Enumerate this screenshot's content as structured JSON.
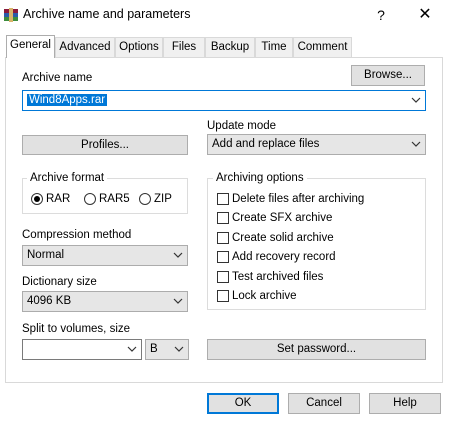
{
  "window": {
    "title": "Archive name and parameters",
    "help_label": "?",
    "close_label": "✕"
  },
  "tabs": [
    {
      "label": "General",
      "active": true
    },
    {
      "label": "Advanced"
    },
    {
      "label": "Options"
    },
    {
      "label": "Files"
    },
    {
      "label": "Backup"
    },
    {
      "label": "Time"
    },
    {
      "label": "Comment"
    }
  ],
  "archive_name": {
    "label": "Archive name",
    "value": "Wind8Apps.rar",
    "browse_label": "Browse..."
  },
  "profiles_label": "Profiles...",
  "update_mode": {
    "label": "Update mode",
    "selected": "Add and replace files"
  },
  "archive_format": {
    "label": "Archive format",
    "options": [
      {
        "label": "RAR",
        "checked": true
      },
      {
        "label": "RAR5",
        "checked": false
      },
      {
        "label": "ZIP",
        "checked": false
      }
    ]
  },
  "compression_method": {
    "label": "Compression method",
    "selected": "Normal"
  },
  "dictionary_size": {
    "label": "Dictionary size",
    "selected": "4096 KB"
  },
  "split_volumes": {
    "label": "Split to volumes, size",
    "value": "",
    "unit": "B"
  },
  "archiving_options": {
    "label": "Archiving options",
    "items": [
      {
        "label": "Delete files after archiving",
        "checked": false
      },
      {
        "label": "Create SFX archive",
        "checked": false
      },
      {
        "label": "Create solid archive",
        "checked": false
      },
      {
        "label": "Add recovery record",
        "checked": false
      },
      {
        "label": "Test archived files",
        "checked": false
      },
      {
        "label": "Lock archive",
        "checked": false
      }
    ]
  },
  "set_password_label": "Set password...",
  "footer": {
    "ok_label": "OK",
    "cancel_label": "Cancel",
    "help_label": "Help"
  },
  "colors": {
    "accent": "#0078d7",
    "button_face": "#e1e1e1",
    "tab_inactive": "#f0f0f0"
  }
}
